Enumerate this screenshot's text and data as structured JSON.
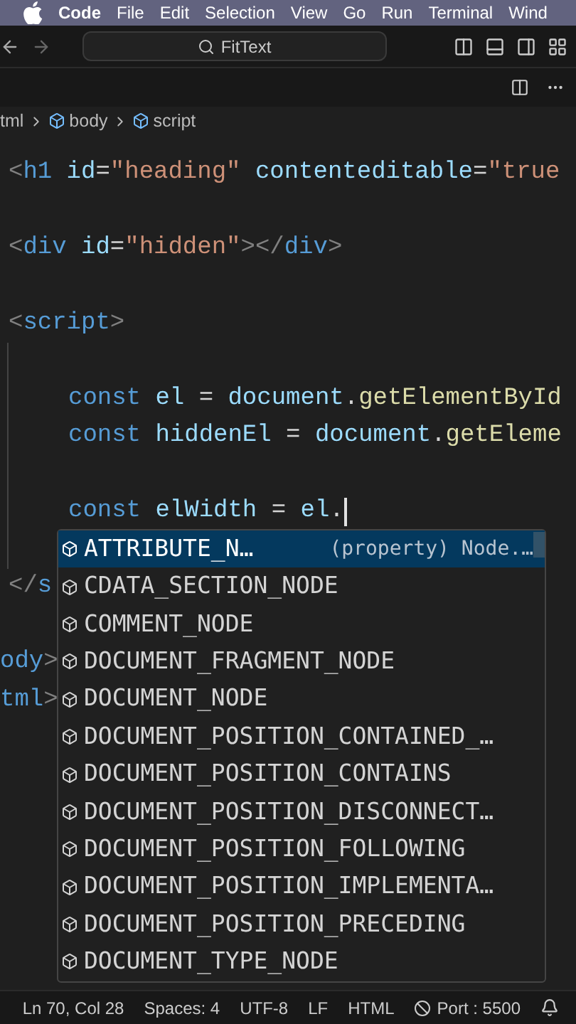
{
  "menu_bar": {
    "app": "Code",
    "items": [
      "File",
      "Edit",
      "Selection",
      "View",
      "Go",
      "Run",
      "Terminal",
      "Wind"
    ]
  },
  "title_bar": {
    "search": {
      "value": "FitText"
    }
  },
  "breadcrumb": [
    {
      "label": "tml",
      "kind": "text"
    },
    {
      "label": "body",
      "kind": "element"
    },
    {
      "label": "script",
      "kind": "element"
    }
  ],
  "code_lines": [
    {
      "indent": false,
      "tokens": [
        {
          "text": "<",
          "kind": "punct"
        },
        {
          "text": "h1",
          "kind": "tag"
        },
        {
          "text": " id",
          "kind": "attr"
        },
        {
          "text": "=",
          "kind": "plain"
        },
        {
          "text": "\"heading\"",
          "kind": "string"
        },
        {
          "text": " contenteditable",
          "kind": "attr"
        },
        {
          "text": "=",
          "kind": "plain"
        },
        {
          "text": "\"true",
          "kind": "string"
        }
      ]
    },
    {
      "indent": false
    },
    {
      "indent": false,
      "tokens": [
        {
          "text": "<",
          "kind": "punct"
        },
        {
          "text": "div",
          "kind": "tag"
        },
        {
          "text": " id",
          "kind": "attr"
        },
        {
          "text": "=",
          "kind": "plain"
        },
        {
          "text": "\"hidden\"",
          "kind": "string"
        },
        {
          "text": "></",
          "kind": "punct"
        },
        {
          "text": "div",
          "kind": "tag"
        },
        {
          "text": ">",
          "kind": "punct"
        }
      ]
    },
    {
      "indent": false
    },
    {
      "indent": false,
      "tokens": [
        {
          "text": "<",
          "kind": "punct"
        },
        {
          "text": "script",
          "kind": "tag"
        },
        {
          "text": ">",
          "kind": "punct"
        }
      ]
    },
    {
      "indent": true
    },
    {
      "indent": true,
      "tokens": [
        {
          "text": "const",
          "kind": "keyword"
        },
        {
          "text": " el",
          "kind": "variable"
        },
        {
          "text": " = ",
          "kind": "plain"
        },
        {
          "text": "document",
          "kind": "variable"
        },
        {
          "text": ".",
          "kind": "plain"
        },
        {
          "text": "getElementById",
          "kind": "function"
        }
      ]
    },
    {
      "indent": true,
      "tokens": [
        {
          "text": "const",
          "kind": "keyword"
        },
        {
          "text": " hiddenEl",
          "kind": "variable"
        },
        {
          "text": " = ",
          "kind": "plain"
        },
        {
          "text": "document",
          "kind": "variable"
        },
        {
          "text": ".",
          "kind": "plain"
        },
        {
          "text": "getEleme",
          "kind": "function"
        }
      ]
    },
    {
      "indent": true
    },
    {
      "indent": true,
      "cursor": true,
      "tokens": [
        {
          "text": "const",
          "kind": "keyword"
        },
        {
          "text": " elWidth",
          "kind": "variable"
        },
        {
          "text": " = ",
          "kind": "plain"
        },
        {
          "text": "el",
          "kind": "variable"
        },
        {
          "text": ".",
          "kind": "plain"
        }
      ]
    },
    {
      "indent": true
    },
    {
      "indent": false,
      "tokens": [
        {
          "text": "</",
          "kind": "punct"
        },
        {
          "text": "s",
          "kind": "tag"
        }
      ]
    },
    {
      "indent": false
    },
    {
      "indent": false,
      "cut": true,
      "tokens": [
        {
          "text": "ody",
          "kind": "tag"
        },
        {
          "text": ">",
          "kind": "punct"
        }
      ]
    },
    {
      "indent": false,
      "cut": true,
      "tokens": [
        {
          "text": "tml",
          "kind": "tag"
        },
        {
          "text": ">",
          "kind": "punct"
        }
      ]
    }
  ],
  "suggestions": [
    {
      "label": "ATTRIBUTE_N…",
      "detail": "(property) Node.…",
      "selected": true
    },
    {
      "label": "CDATA_SECTION_NODE",
      "selected": false
    },
    {
      "label": "COMMENT_NODE",
      "selected": false
    },
    {
      "label": "DOCUMENT_FRAGMENT_NODE",
      "selected": false
    },
    {
      "label": "DOCUMENT_NODE",
      "selected": false
    },
    {
      "label": "DOCUMENT_POSITION_CONTAINED_…",
      "selected": false
    },
    {
      "label": "DOCUMENT_POSITION_CONTAINS",
      "selected": false
    },
    {
      "label": "DOCUMENT_POSITION_DISCONNECT…",
      "selected": false
    },
    {
      "label": "DOCUMENT_POSITION_FOLLOWING",
      "selected": false
    },
    {
      "label": "DOCUMENT_POSITION_IMPLEMENTA…",
      "selected": false
    },
    {
      "label": "DOCUMENT_POSITION_PRECEDING",
      "selected": false
    },
    {
      "label": "DOCUMENT_TYPE_NODE",
      "selected": false
    }
  ],
  "status_bar": [
    {
      "text": "Ln 70, Col 28",
      "kind": "text"
    },
    {
      "text": "Spaces: 4",
      "kind": "text"
    },
    {
      "text": "UTF-8",
      "kind": "text"
    },
    {
      "text": "LF",
      "kind": "text"
    },
    {
      "text": "HTML",
      "kind": "text"
    },
    {
      "text": "Port : 5500",
      "kind": "port"
    },
    {
      "kind": "bell"
    }
  ]
}
